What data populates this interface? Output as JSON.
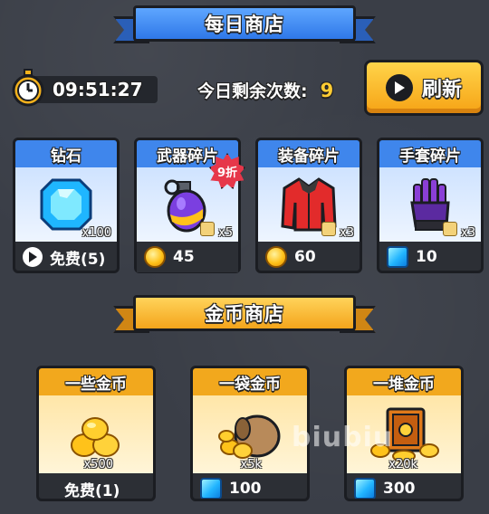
{
  "daily_shop": {
    "title": "每日商店",
    "timer": "09:51:27",
    "remaining_label": "今日剩余次数:",
    "remaining_count": "9",
    "refresh_label": "刷新",
    "items": [
      {
        "name": "钻石",
        "icon": "diamond-icon",
        "qty": "x100",
        "price": "免费(5)",
        "currency": "video-ad",
        "discount": null
      },
      {
        "name": "武器碎片",
        "icon": "grenade-icon",
        "qty": "x5",
        "price": "45",
        "currency": "coin",
        "discount": "9折"
      },
      {
        "name": "装备碎片",
        "icon": "jacket-icon",
        "qty": "x3",
        "price": "60",
        "currency": "coin",
        "discount": null
      },
      {
        "name": "手套碎片",
        "icon": "glove-icon",
        "qty": "x3",
        "price": "10",
        "currency": "gem",
        "discount": null
      }
    ]
  },
  "coin_shop": {
    "title": "金币商店",
    "items": [
      {
        "name": "一些金币",
        "icon": "coin-pile-icon",
        "qty": "x500",
        "price": "免费(1)",
        "currency": "none"
      },
      {
        "name": "一袋金币",
        "icon": "coin-bag-icon",
        "qty": "x5k",
        "price": "100",
        "currency": "gem"
      },
      {
        "name": "一堆金币",
        "icon": "coin-safe-icon",
        "qty": "x20k",
        "price": "300",
        "currency": "gem"
      }
    ]
  },
  "watermark": "biubiu",
  "colors": {
    "blue": "#3f86ec",
    "gold": "#f2a81d",
    "background": "#3a3e47"
  }
}
